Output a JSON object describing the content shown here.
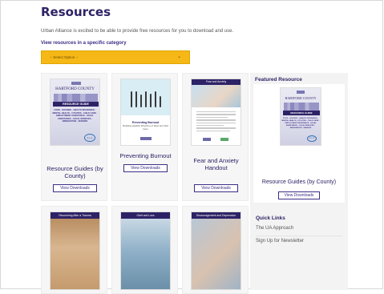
{
  "header": {
    "title": "Resources",
    "intro": "Urban Alliance is excited to be able to provide free resources for you to download and use.",
    "category_link": "View resources in a specific category",
    "select_placeholder": "-- Select Option --"
  },
  "cover_text": {
    "county": "HARTFORD COUNTY",
    "banner": "RESOURCE GUIDE",
    "topics": "FOOD · HOUSING · HEALTH INSURANCE · MENTAL HEALTH · UTILITIES · CHILD CARE · EMPLOYMENT ASSISTANCE · LEGAL ASSISTANCE · LOCAL SERVICES · IMMIGRATION · SENIORS",
    "badge": "2-1-1",
    "burnout_title": "Preventing Burnout",
    "burnout_sub": "Building Healthy Rhythms of Rest and Self Care",
    "fear_header": "Fear and Anxiety",
    "row2_headers": [
      "Recovering After a Trauma",
      "Grief and Loss",
      "Discouragement and Depression"
    ]
  },
  "cards": [
    {
      "title": "Resource Guides (by County)",
      "button": "View Downloads"
    },
    {
      "title": "Preventing Burnout",
      "button": "View Downloads"
    },
    {
      "title": "Fear and Anxiety Handout",
      "button": "View Downloads"
    }
  ],
  "sidebar": {
    "featured_heading": "Featured Resource",
    "featured_title": "Resource Guides (by County)",
    "featured_button": "View Downloads",
    "quick_links_heading": "Quick Links",
    "quick_links": [
      "The UA Approach",
      "Sign Up for Newsletter"
    ]
  },
  "colors": {
    "brand_navy": "#2e2266",
    "accent_yellow": "#f6b817",
    "link_purple": "#3c2e86"
  },
  "icons": {
    "select_chevron": "chevron-down-icon"
  }
}
